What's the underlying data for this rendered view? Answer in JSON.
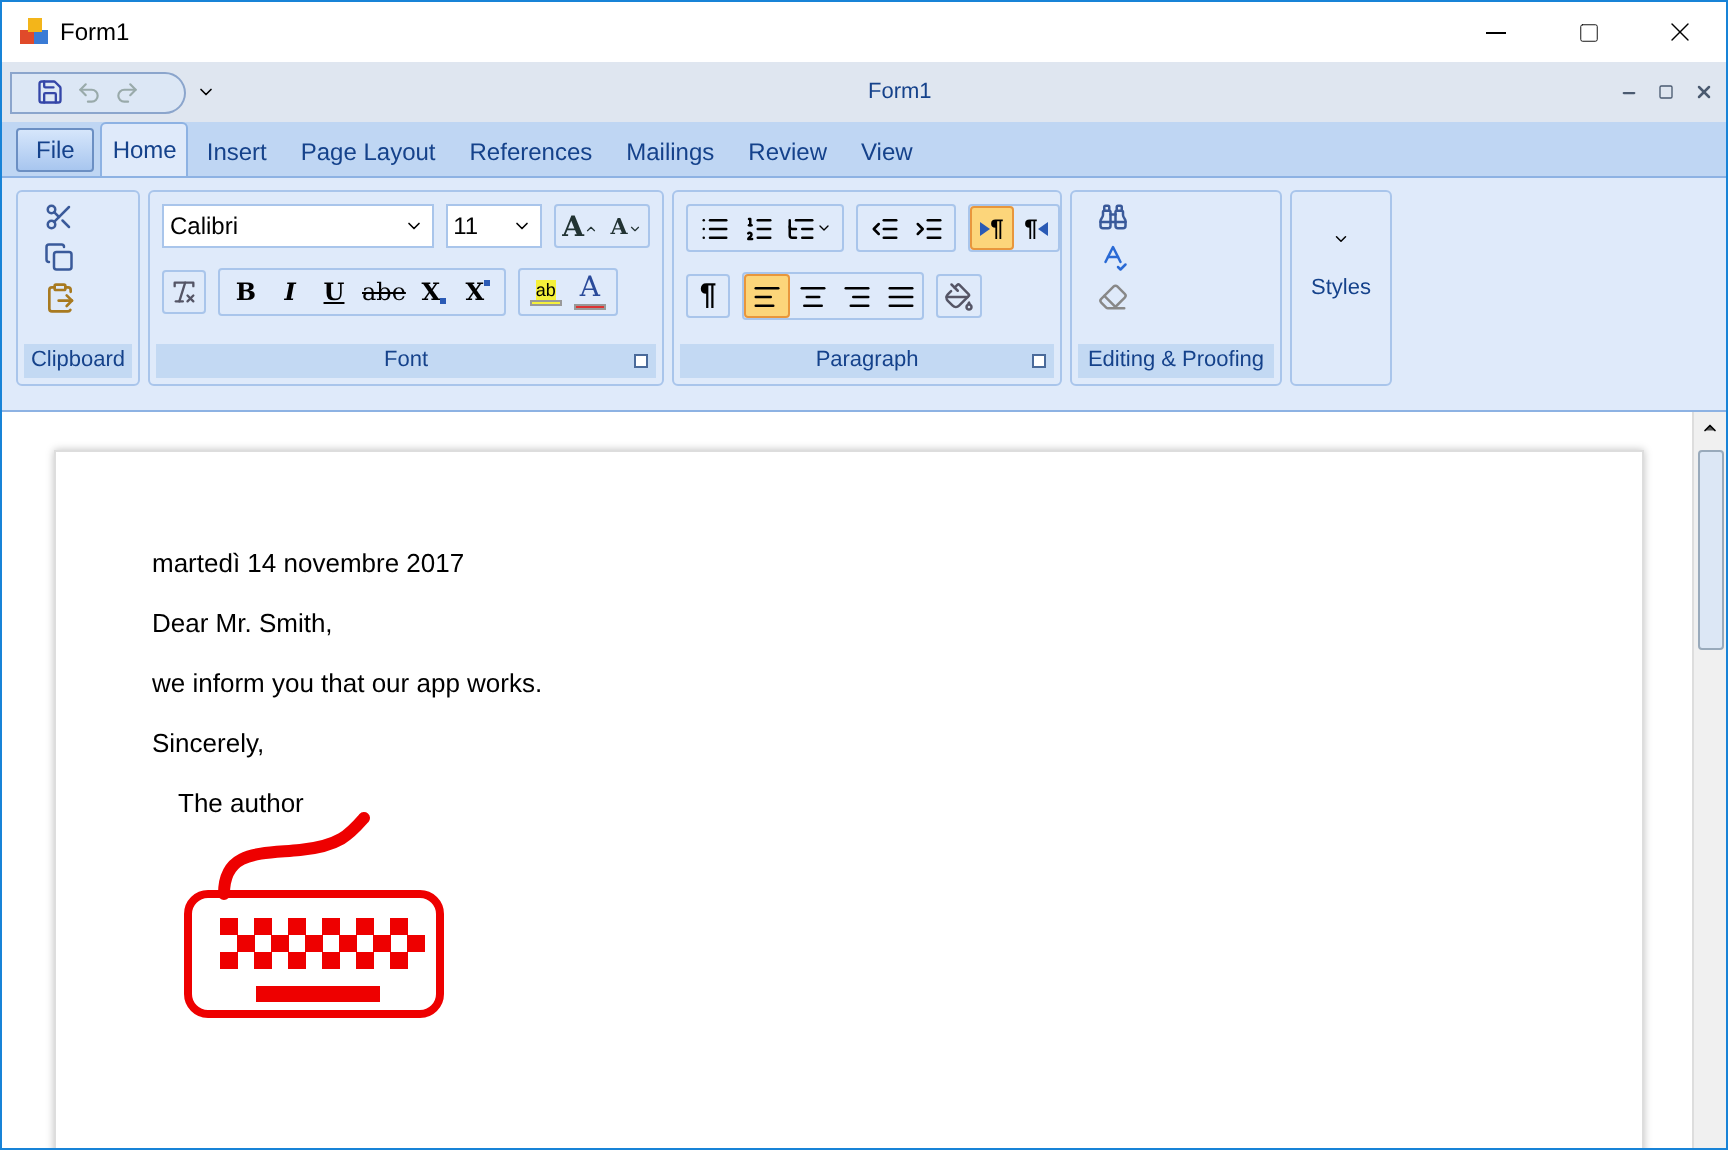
{
  "window": {
    "title": "Form1"
  },
  "quick_access": {
    "title": "Form1"
  },
  "file_button": {
    "label": "File"
  },
  "tabs": [
    {
      "label": "Home",
      "selected": true
    },
    {
      "label": "Insert",
      "selected": false
    },
    {
      "label": "Page Layout",
      "selected": false
    },
    {
      "label": "References",
      "selected": false
    },
    {
      "label": "Mailings",
      "selected": false
    },
    {
      "label": "Review",
      "selected": false
    },
    {
      "label": "View",
      "selected": false
    }
  ],
  "clipboard": {
    "label": "Clipboard"
  },
  "font": {
    "label": "Font",
    "font_name": "Calibri",
    "font_size": "11",
    "grow": "A",
    "shrink": "A",
    "format_buttons": [
      {
        "kind": "bold",
        "label": "B"
      },
      {
        "kind": "italic",
        "label": "I"
      },
      {
        "kind": "underline",
        "label": "U"
      },
      {
        "kind": "strike",
        "label": "abe"
      },
      {
        "kind": "subscript",
        "label": "X"
      },
      {
        "kind": "superscript",
        "label": "X"
      }
    ],
    "highlight": "ab",
    "font_color": "A"
  },
  "paragraph": {
    "label": "Paragraph",
    "show_marks": "¶",
    "direction": [
      {
        "kind": "ltr",
        "label": "¶",
        "selected": true
      },
      {
        "kind": "rtl",
        "label": "¶",
        "selected": false
      }
    ],
    "alignment": [
      {
        "kind": "left",
        "selected": true
      },
      {
        "kind": "center",
        "selected": false
      },
      {
        "kind": "right",
        "selected": false
      },
      {
        "kind": "justify",
        "selected": false
      }
    ]
  },
  "editing": {
    "label": "Editing & Proofing"
  },
  "styles": {
    "label": "Styles"
  },
  "document": {
    "paragraphs": [
      "martedì 14 novembre 2017",
      "Dear Mr. Smith,",
      "we inform you that our app works.",
      "Sincerely,"
    ],
    "signature": "The author"
  }
}
